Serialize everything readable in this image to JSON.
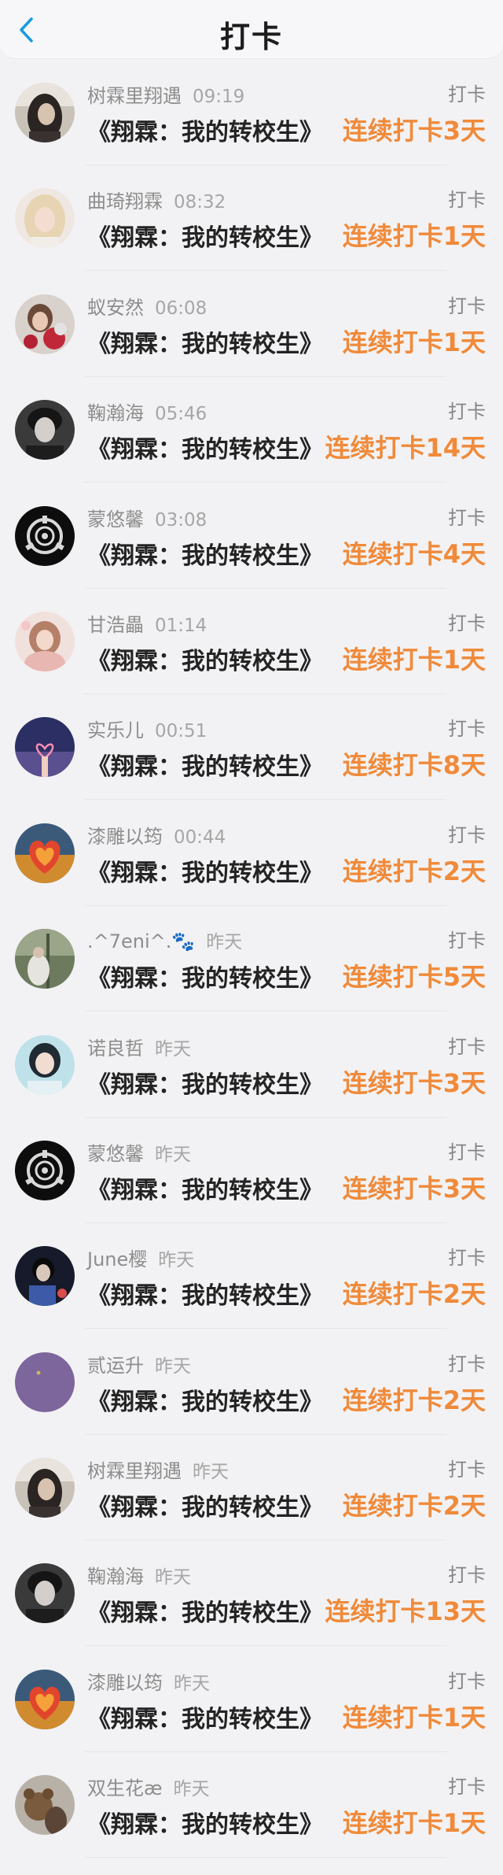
{
  "header": {
    "title": "打卡",
    "back_icon": "chevron-left-icon",
    "accent_color": "#1a9bdf"
  },
  "streak_color": "#f08a3a",
  "entries": [
    {
      "name": "树霖里翔遇",
      "time": "09:19",
      "tag": "打卡",
      "book": "《翔霖：我的转校生》",
      "streak": "连续打卡3天",
      "avatar": "photo-dark-hair"
    },
    {
      "name": "曲琦翔霖",
      "time": "08:32",
      "tag": "打卡",
      "book": "《翔霖：我的转校生》",
      "streak": "连续打卡1天",
      "avatar": "photo-blonde"
    },
    {
      "name": "蚁安然",
      "time": "06:08",
      "tag": "打卡",
      "book": "《翔霖：我的转校生》",
      "streak": "连续打卡1天",
      "avatar": "photo-flowers"
    },
    {
      "name": "鞠瀚海",
      "time": "05:46",
      "tag": "打卡",
      "book": "《翔霖：我的转校生》",
      "streak": "连续打卡14天",
      "avatar": "photo-portrait-bw"
    },
    {
      "name": "蒙悠馨",
      "time": "03:08",
      "tag": "打卡",
      "book": "《翔霖：我的转校生》",
      "streak": "连续打卡4天",
      "avatar": "scp-logo"
    },
    {
      "name": "甘浩畾",
      "time": "01:14",
      "tag": "打卡",
      "book": "《翔霖：我的转校生》",
      "streak": "连续打卡1天",
      "avatar": "photo-pink"
    },
    {
      "name": "实乐儿",
      "time": "00:51",
      "tag": "打卡",
      "book": "《翔霖：我的转校生》",
      "streak": "连续打卡8天",
      "avatar": "photo-heart-hand"
    },
    {
      "name": "漆雕以筠",
      "time": "00:44",
      "tag": "打卡",
      "book": "《翔霖：我的转校生》",
      "streak": "连续打卡2天",
      "avatar": "heart-art"
    },
    {
      "name": ".^7eni^.🐾",
      "time": "昨天",
      "tag": "打卡",
      "book": "《翔霖：我的转校生》",
      "streak": "连续打卡5天",
      "avatar": "photo-green"
    },
    {
      "name": "诺良哲",
      "time": "昨天",
      "tag": "打卡",
      "book": "《翔霖：我的转校生》",
      "streak": "连续打卡3天",
      "avatar": "photo-cyan-portrait"
    },
    {
      "name": "蒙悠馨",
      "time": "昨天",
      "tag": "打卡",
      "book": "《翔霖：我的转校生》",
      "streak": "连续打卡3天",
      "avatar": "scp-logo"
    },
    {
      "name": "June樱",
      "time": "昨天",
      "tag": "打卡",
      "book": "《翔霖：我的转校生》",
      "streak": "连续打卡2天",
      "avatar": "photo-dark-blue"
    },
    {
      "name": "贰运升",
      "time": "昨天",
      "tag": "打卡",
      "book": "《翔霖：我的转校生》",
      "streak": "连续打卡2天",
      "avatar": "plain-purple"
    },
    {
      "name": "树霖里翔遇",
      "time": "昨天",
      "tag": "打卡",
      "book": "《翔霖：我的转校生》",
      "streak": "连续打卡2天",
      "avatar": "photo-dark-hair"
    },
    {
      "name": "鞠瀚海",
      "time": "昨天",
      "tag": "打卡",
      "book": "《翔霖：我的转校生》",
      "streak": "连续打卡13天",
      "avatar": "photo-portrait-bw"
    },
    {
      "name": "漆雕以筠",
      "time": "昨天",
      "tag": "打卡",
      "book": "《翔霖：我的转校生》",
      "streak": "连续打卡1天",
      "avatar": "heart-art"
    },
    {
      "name": "双生花æ",
      "time": "昨天",
      "tag": "打卡",
      "book": "《翔霖：我的转校生》",
      "streak": "连续打卡1天",
      "avatar": "photo-teddy"
    }
  ]
}
